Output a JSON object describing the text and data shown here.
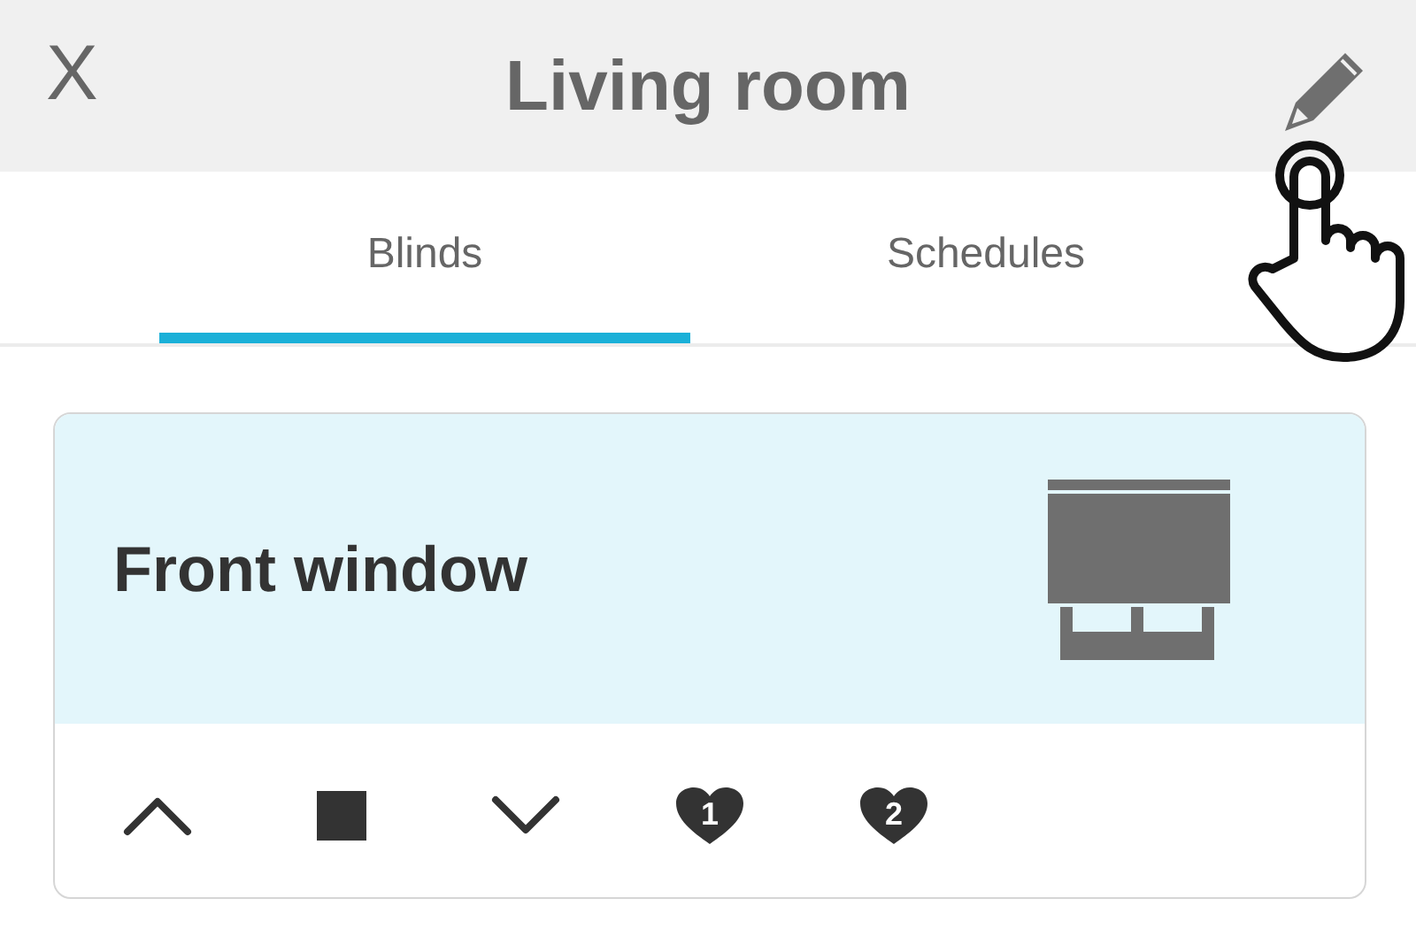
{
  "header": {
    "close": "X",
    "title": "Living room"
  },
  "tabs": [
    {
      "label": "Blinds",
      "selected": true
    },
    {
      "label": "Schedules",
      "selected": false
    }
  ],
  "card": {
    "name": "Front window",
    "controls": [
      {
        "kind": "up"
      },
      {
        "kind": "stop"
      },
      {
        "kind": "down"
      },
      {
        "kind": "favorite",
        "label": "1"
      },
      {
        "kind": "favorite",
        "label": "2"
      }
    ]
  }
}
